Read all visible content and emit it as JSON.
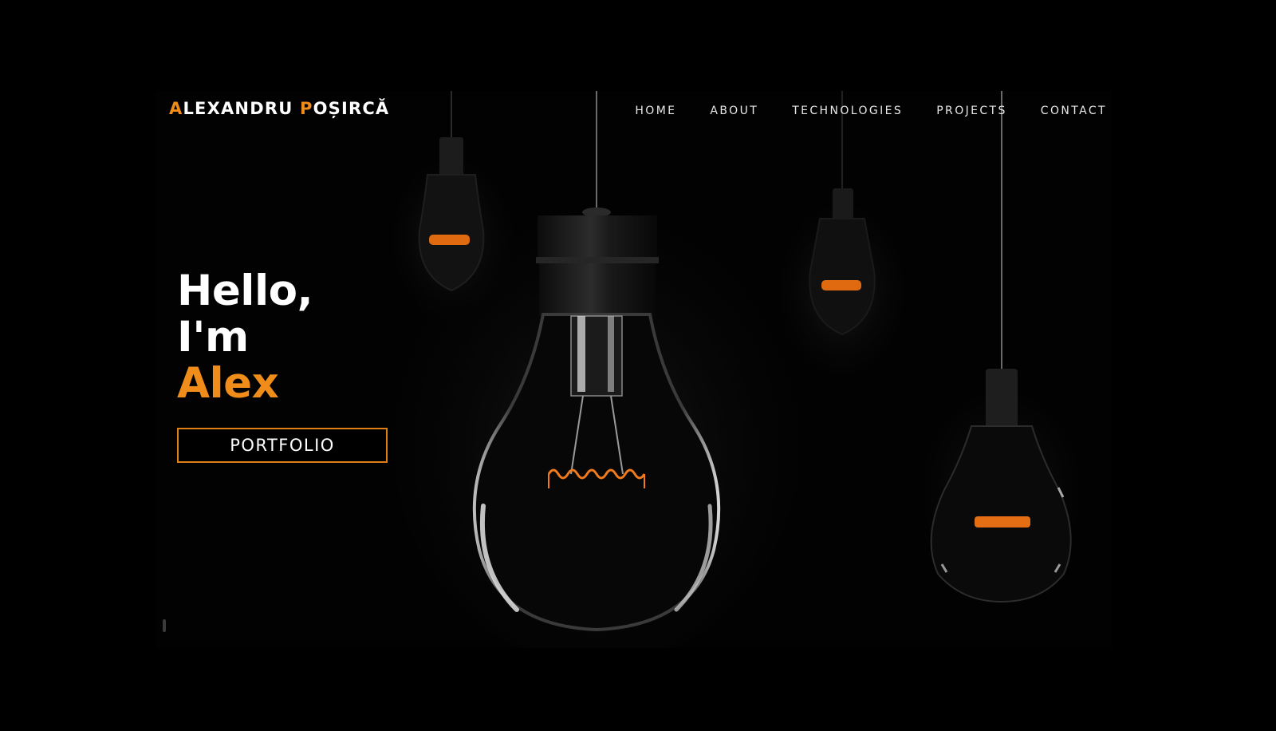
{
  "header": {
    "logo_first_initial": "A",
    "logo_first_rest": "LEXANDRU ",
    "logo_last_initial": "P",
    "logo_last_rest": "OȘIRCĂ"
  },
  "nav": {
    "items": [
      {
        "label": "HOME"
      },
      {
        "label": "ABOUT"
      },
      {
        "label": "TECHNOLOGIES"
      },
      {
        "label": "PROJECTS"
      },
      {
        "label": "CONTACT"
      }
    ]
  },
  "hero": {
    "greeting_line1": "Hello,",
    "greeting_line2": "I'm",
    "name": "Alex",
    "button_label": "PORTFOLIO"
  },
  "colors": {
    "accent": "#f08c1a",
    "background": "#000000",
    "text": "#ffffff"
  },
  "icons": {
    "hero_image": "hanging-light-bulbs"
  }
}
